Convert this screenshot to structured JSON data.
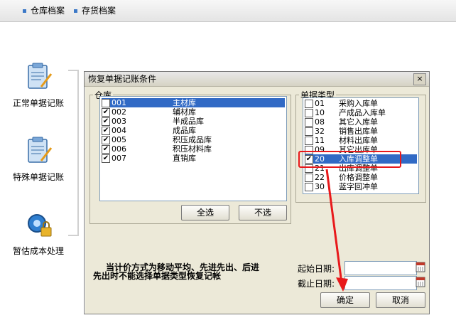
{
  "topnav": {
    "items": [
      {
        "label": "仓库档案"
      },
      {
        "label": "存货档案"
      }
    ]
  },
  "sidebar": {
    "items": [
      {
        "label": "正常单据记账"
      },
      {
        "label": "特殊单据记账"
      },
      {
        "label": "暂估成本处理"
      }
    ]
  },
  "dialog": {
    "title": "恢复单据记账条件",
    "close_glyph": "×",
    "warehouse": {
      "legend": "仓库",
      "rows": [
        {
          "code": "001",
          "name": "主材库",
          "checked": "✔"
        },
        {
          "code": "002",
          "name": "辅材库",
          "checked": "✔"
        },
        {
          "code": "003",
          "name": "半成品库",
          "checked": "✔"
        },
        {
          "code": "004",
          "name": "成品库",
          "checked": "✔"
        },
        {
          "code": "005",
          "name": "积压成品库",
          "checked": "✔"
        },
        {
          "code": "006",
          "name": "积压材料库",
          "checked": "✔"
        },
        {
          "code": "007",
          "name": "直销库",
          "checked": "✔"
        }
      ],
      "select_all_label": "全选",
      "select_none_label": "不选"
    },
    "doctype": {
      "legend": "单据类型",
      "rows": [
        {
          "code": "01",
          "name": "采购入库单",
          "checked": ""
        },
        {
          "code": "10",
          "name": "产成品入库单",
          "checked": ""
        },
        {
          "code": "08",
          "name": "其它入库单",
          "checked": ""
        },
        {
          "code": "32",
          "name": "销售出库单",
          "checked": ""
        },
        {
          "code": "11",
          "name": "材料出库单",
          "checked": ""
        },
        {
          "code": "09",
          "name": "其它出库单",
          "checked": ""
        },
        {
          "code": "20",
          "name": "入库调整单",
          "checked": "✔"
        },
        {
          "code": "21",
          "name": "出库调整单",
          "checked": ""
        },
        {
          "code": "22",
          "name": "价格调整单",
          "checked": ""
        },
        {
          "code": "30",
          "name": "蓝字回冲单",
          "checked": ""
        }
      ]
    },
    "note_line1": "当计价方式为移动平均、先进先出、后进",
    "note_line2": "先出时不能选择单据类型恢复记帐",
    "start_date_label": "起始日期:",
    "start_date_value": "",
    "end_date_label": "截止日期:",
    "end_date_value": "",
    "ok_label": "确定",
    "cancel_label": "取消"
  },
  "colors": {
    "highlight_box": "#e8191b",
    "selection": "#316ac5",
    "arrow": "#e8191b"
  }
}
